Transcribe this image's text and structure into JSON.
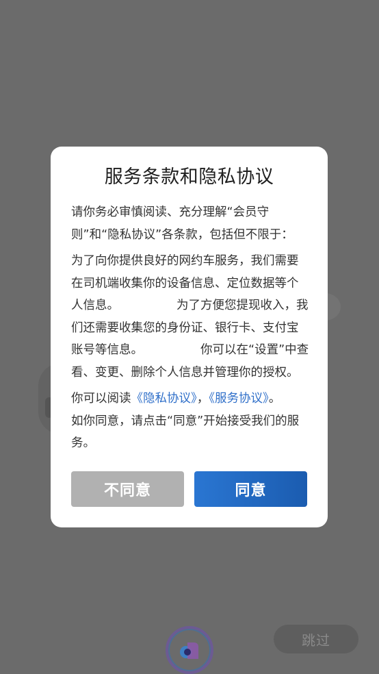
{
  "dialog": {
    "title": "服务条款和隐私协议",
    "intro": "请你务必审慎阅读、充分理解“会员守则”和“隐私协议”各条款，包括但不限于：",
    "info_a": "为了向你提供良好的网约车服务，我们需要在司机端收集你的设备信息、定位数据等个人信息。",
    "info_b": "为了方便您提现收入，我们还需要收集您的身份证、银行卡、支付宝账号等信息。",
    "info_c": "你可以在“设置”中查看、变更、删除个人信息并管理你的授权。",
    "read_prefix": "你可以阅读",
    "privacy_link": "《隐私协议》",
    "comma": "，",
    "service_link": "《服务协议》",
    "period": "。",
    "agree_text": "如你同意，请点击“同意”开始接受我们的服务。",
    "disagree_label": "不同意",
    "agree_label": "同意"
  },
  "skip_label": "跳过",
  "colors": {
    "overlay": "#6b6b6b",
    "link": "#2f6fc9",
    "agree_button": "#2a76d2",
    "disagree_button": "#b1b1b1"
  },
  "icons": {
    "bottom_logo": "app-logo-icon"
  }
}
